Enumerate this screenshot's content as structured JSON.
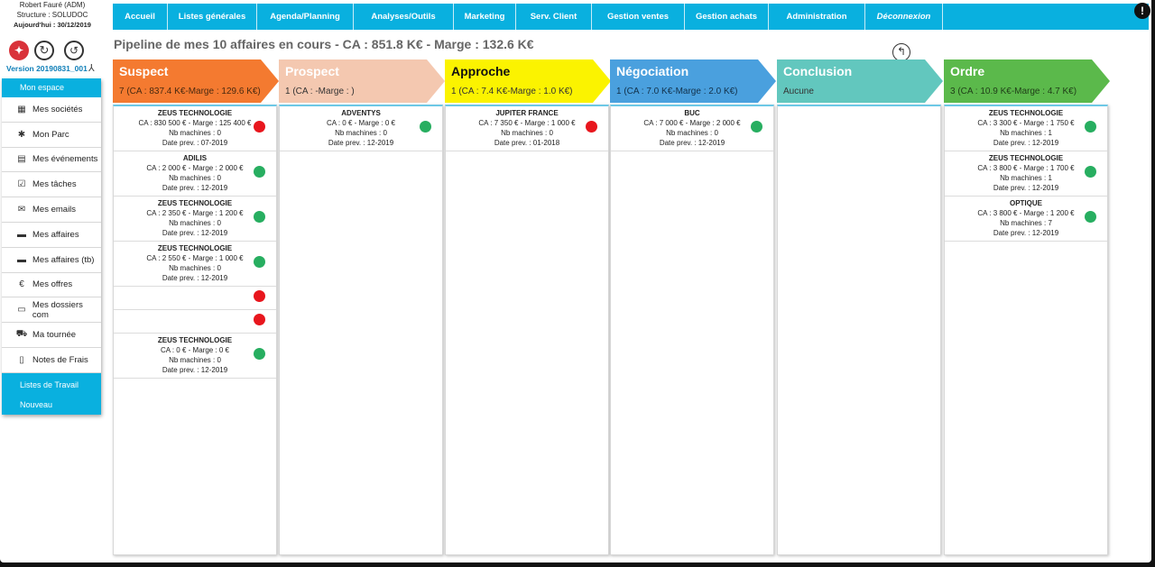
{
  "user": {
    "name": "Robert Fauré (ADM)",
    "structure": "Structure : SOLUDOC",
    "today": "Aujourd'hui : 30/12/2019"
  },
  "version": "Version 20190831_001",
  "icons": {
    "logo": "app-logo-icon",
    "refresh": "refresh-icon",
    "history": "history-icon",
    "pdf": "pdf-icon",
    "alert": "alert-icon",
    "back": "back-arrow-icon"
  },
  "sidebar": {
    "top_label": "Mon espace",
    "items": [
      {
        "label": "Mes sociétés",
        "icon": "▦",
        "name": "building-icon"
      },
      {
        "label": "Mon Parc",
        "icon": "✱",
        "name": "puzzle-icon"
      },
      {
        "label": "Mes événements",
        "icon": "▤",
        "name": "calendar-icon"
      },
      {
        "label": "Mes tâches",
        "icon": "☑",
        "name": "clipboard-icon"
      },
      {
        "label": "Mes emails",
        "icon": "✉",
        "name": "envelope-icon"
      },
      {
        "label": "Mes affaires",
        "icon": "▬",
        "name": "briefcase-icon"
      },
      {
        "label": "Mes affaires (tb)",
        "icon": "▬",
        "name": "briefcase-tb-icon"
      },
      {
        "label": "Mes offres",
        "icon": "€",
        "name": "euro-icon"
      },
      {
        "label": "Mes dossiers com",
        "icon": "▭",
        "name": "folder-icon"
      },
      {
        "label": "Ma tournée",
        "icon": "⛟",
        "name": "car-icon"
      },
      {
        "label": "Notes de Frais",
        "icon": "▯",
        "name": "document-icon"
      }
    ],
    "bottom_items": [
      "Listes de Travail",
      "Nouveau"
    ]
  },
  "nav": [
    {
      "label": "Accueil",
      "italic": false
    },
    {
      "label": "Listes générales",
      "italic": false
    },
    {
      "label": "Agenda/Planning",
      "italic": false
    },
    {
      "label": "Analyses/Outils",
      "italic": false
    },
    {
      "label": "Marketing",
      "italic": false
    },
    {
      "label": "Serv. Client",
      "italic": false
    },
    {
      "label": "Gestion ventes",
      "italic": false
    },
    {
      "label": "Gestion achats",
      "italic": false
    },
    {
      "label": "Administration",
      "italic": false
    },
    {
      "label": "Déconnexion",
      "italic": true
    }
  ],
  "page_title": "Pipeline de mes 10 affaires en cours - CA : 851.8 K€ - Marge : 132.6 K€",
  "colors": {
    "accent": "#09b0df",
    "green": "#27ae60",
    "red": "#e8161d"
  },
  "stages": [
    {
      "name": "Suspect",
      "summary": "7 (CA : 837.4 K€-Marge : 129.6 K€)",
      "color": "#f47a30",
      "text_color": "#ffffff",
      "summary_color": "#4a2a10",
      "cards": [
        {
          "title": "ZEUS TECHNOLOGIE",
          "ca": "CA : 830 500 € - Marge : 125 400 €",
          "machines": "Nb machines : 0",
          "date": "Date prev. : 07-2019",
          "status": "red"
        },
        {
          "title": "ADILIS",
          "ca": "CA : 2 000 € - Marge : 2 000 €",
          "machines": "Nb machines : 0",
          "date": "Date prev. : 12-2019",
          "status": "green"
        },
        {
          "title": "ZEUS TECHNOLOGIE",
          "ca": "CA : 2 350 € - Marge : 1 200 €",
          "machines": "Nb machines : 0",
          "date": "Date prev. : 12-2019",
          "status": "green"
        },
        {
          "title": "ZEUS TECHNOLOGIE",
          "ca": "CA : 2 550 € - Marge : 1 000 €",
          "machines": "Nb machines : 0",
          "date": "Date prev. : 12-2019",
          "status": "green"
        },
        {
          "title": "",
          "ca": "",
          "machines": "",
          "date": "",
          "status": "red"
        },
        {
          "title": "",
          "ca": "",
          "machines": "",
          "date": "",
          "status": "red"
        },
        {
          "title": "ZEUS TECHNOLOGIE",
          "ca": "CA : 0 € - Marge : 0 €",
          "machines": "Nb machines : 0",
          "date": "Date prev. : 12-2019",
          "status": "green"
        }
      ]
    },
    {
      "name": "Prospect",
      "summary": "1 (CA : -Marge : )",
      "color": "#f4c8b0",
      "text_color": "#ffffff",
      "summary_color": "#333333",
      "cards": [
        {
          "title": "ADVENTYS",
          "ca": "CA : 0 € - Marge : 0 €",
          "machines": "Nb machines : 0",
          "date": "Date prev. : 12-2019",
          "status": "green"
        }
      ]
    },
    {
      "name": "Approche",
      "summary": "1 (CA : 7.4 K€-Marge : 1.0 K€)",
      "color": "#fbf300",
      "text_color": "#111111",
      "summary_color": "#333333",
      "cards": [
        {
          "title": "JUPITER FRANCE",
          "ca": "CA : 7 350 € - Marge : 1 000 €",
          "machines": "Nb machines : 0",
          "date": "Date prev. : 01-2018",
          "status": "red"
        }
      ]
    },
    {
      "name": "Négociation",
      "summary": "1 (CA : 7.0 K€-Marge : 2.0 K€)",
      "color": "#4aa0de",
      "text_color": "#ffffff",
      "summary_color": "#12314a",
      "cards": [
        {
          "title": "BUC",
          "ca": "CA : 7 000 € - Marge : 2 000 €",
          "machines": "Nb machines : 0",
          "date": "Date prev. : 12-2019",
          "status": "green"
        }
      ]
    },
    {
      "name": "Conclusion",
      "summary": "Aucune",
      "color": "#62c7be",
      "text_color": "#ffffff",
      "summary_color": "#333333",
      "cards": []
    },
    {
      "name": "Ordre",
      "summary": "3 (CA : 10.9 K€-Marge : 4.7 K€)",
      "color": "#5bb94b",
      "text_color": "#ffffff",
      "summary_color": "#1f3d18",
      "cards": [
        {
          "title": "ZEUS TECHNOLOGIE",
          "ca": "CA : 3 300 € - Marge : 1 750 €",
          "machines": "Nb machines : 1",
          "date": "Date prev. : 12-2019",
          "status": "green"
        },
        {
          "title": "ZEUS TECHNOLOGIE",
          "ca": "CA : 3 800 € - Marge : 1 700 €",
          "machines": "Nb machines : 1",
          "date": "Date prev. : 12-2019",
          "status": "green"
        },
        {
          "title": "OPTIQUE",
          "ca": "CA : 3 800 € - Marge : 1 200 €",
          "machines": "Nb machines : 7",
          "date": "Date prev. : 12-2019",
          "status": "green"
        }
      ]
    }
  ]
}
